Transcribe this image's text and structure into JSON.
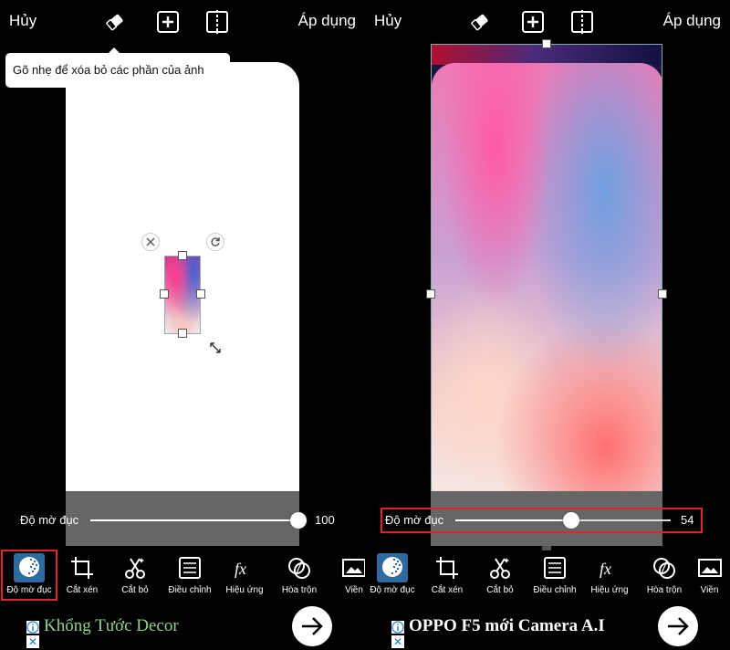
{
  "left": {
    "topbar": {
      "cancel": "Hủy",
      "apply": "Áp dụng"
    },
    "tooltip": "Gõ nhẹ để xóa bỏ các phần của ảnh",
    "slider": {
      "label": "Độ mờ đục",
      "value": "100",
      "fraction": 1.0
    },
    "tools": [
      "Độ mờ đục",
      "Cắt xén",
      "Cắt bỏ",
      "Điều chỉnh",
      "Hiệu ứng",
      "Hòa trộn",
      "Viền"
    ],
    "ad": {
      "title": "Khổng Tước Decor",
      "title_color": "#8fd08f"
    }
  },
  "right": {
    "topbar": {
      "cancel": "Hủy",
      "apply": "Áp dụng"
    },
    "slider": {
      "label": "Độ mờ đục",
      "value": "54",
      "fraction": 0.54
    },
    "tools": [
      "Độ mờ đục",
      "Cắt xén",
      "Cắt bỏ",
      "Điều chỉnh",
      "Hiệu ứng",
      "Hòa trộn",
      "Viền"
    ],
    "ad": {
      "title": "OPPO F5 mới Camera A.I",
      "title_color": "#ffffff"
    }
  },
  "icons": {
    "eraser": "eraser-icon",
    "add": "add-icon",
    "compare": "compare-icon",
    "tools": [
      "opacity-icon",
      "crop-icon",
      "cutout-icon",
      "adjust-icon",
      "effects-icon",
      "blend-icon",
      "border-icon"
    ]
  },
  "colors": {
    "highlight": "#e0242a",
    "active_tool": "#2e6a9e"
  }
}
